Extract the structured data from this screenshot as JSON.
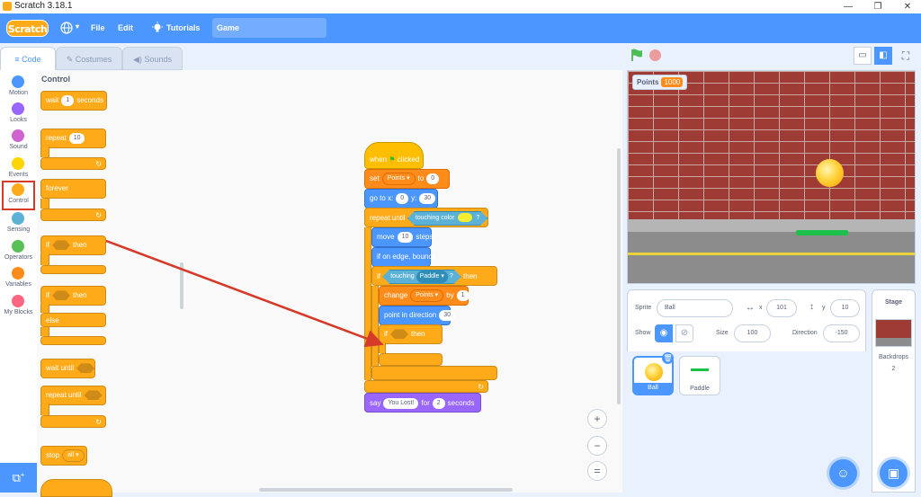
{
  "window": {
    "title": "Scratch 3.18.1",
    "minimize": "—",
    "maximize": "❐",
    "close": "✕"
  },
  "menubar": {
    "logo": "Scratch",
    "globe_icon": "globe-icon",
    "file": "File",
    "edit": "Edit",
    "tutorials": "Tutorials",
    "project_title": "Game"
  },
  "tabs": {
    "code": "Code",
    "costumes": "Costumes",
    "sounds": "Sounds"
  },
  "categories": [
    {
      "label": "Motion",
      "color": "#4c97ff"
    },
    {
      "label": "Looks",
      "color": "#9966ff"
    },
    {
      "label": "Sound",
      "color": "#cf63cf"
    },
    {
      "label": "Events",
      "color": "#ffd500"
    },
    {
      "label": "Control",
      "color": "#ffab19"
    },
    {
      "label": "Sensing",
      "color": "#5cb1d6"
    },
    {
      "label": "Operators",
      "color": "#59c059"
    },
    {
      "label": "Variables",
      "color": "#ff8c1a"
    },
    {
      "label": "My Blocks",
      "color": "#ff6680"
    }
  ],
  "palette": {
    "title": "Control",
    "wait": {
      "label": "wait",
      "value": "1",
      "unit": "seconds"
    },
    "repeat": {
      "label": "repeat",
      "value": "10"
    },
    "forever": "forever",
    "if_then": {
      "if": "if",
      "then": "then"
    },
    "if_else": {
      "if": "if",
      "then": "then",
      "else": "else"
    },
    "wait_until": "wait until",
    "repeat_until": "repeat until",
    "stop": {
      "label": "stop",
      "value": "all"
    }
  },
  "script": {
    "hat": {
      "when": "when",
      "clicked": "clicked"
    },
    "set": {
      "label": "set",
      "var": "Points",
      "to": "to",
      "value": "0"
    },
    "goto": {
      "label": "go to x:",
      "x": "0",
      "y_label": "y:",
      "y": "30"
    },
    "repeat_until": {
      "label": "repeat until",
      "cond": "touching color",
      "q": "?"
    },
    "move": {
      "label": "move",
      "value": "10",
      "unit": "steps"
    },
    "bounce": "if on edge, bounce",
    "if_touching": {
      "if": "if",
      "cond": "touching",
      "target": "Paddle",
      "q": "?",
      "then": "then"
    },
    "change": {
      "label": "change",
      "var": "Points",
      "by": "by",
      "value": "1"
    },
    "point": {
      "label": "point in direction",
      "value": "30"
    },
    "inner_if": {
      "if": "if",
      "then": "then"
    },
    "say": {
      "label": "say",
      "text": "You Lost!",
      "for": "for",
      "value": "2",
      "unit": "seconds"
    }
  },
  "zoom": {
    "in": "+",
    "out": "−",
    "reset": "="
  },
  "stage": {
    "monitor_label": "Points",
    "monitor_value": "1000"
  },
  "sprite_info": {
    "sprite_label": "Sprite",
    "sprite_name": "Ball",
    "x_label": "x",
    "x": "101",
    "y_label": "y",
    "y": "10",
    "show_label": "Show",
    "size_label": "Size",
    "size": "100",
    "direction_label": "Direction",
    "direction": "-150"
  },
  "sprites": [
    {
      "name": "Ball",
      "selected": true
    },
    {
      "name": "Paddle",
      "selected": false
    }
  ],
  "stage_pane": {
    "title": "Stage",
    "backdrops_label": "Backdrops",
    "backdrops_count": "2"
  },
  "colors": {
    "accent": "#4c97ff",
    "control": "#ffab19",
    "annotation": "#d63a2a"
  }
}
